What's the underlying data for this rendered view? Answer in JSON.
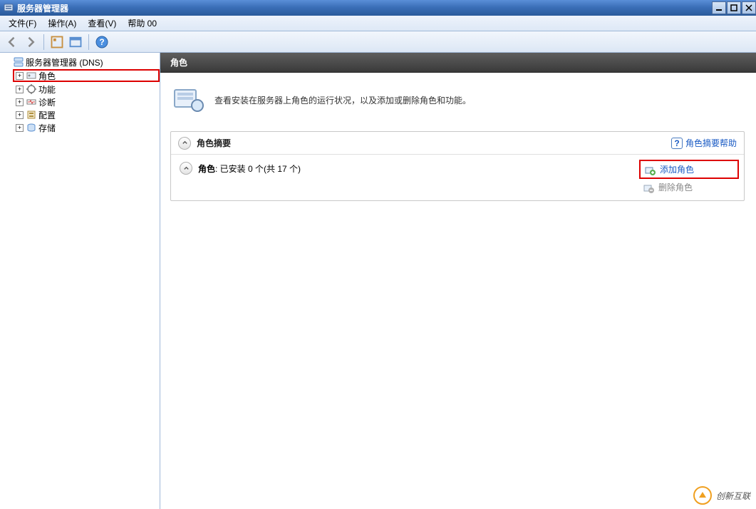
{
  "titlebar": {
    "title": "服务器管理器"
  },
  "menu": {
    "file": "文件(F)",
    "action": "操作(A)",
    "view": "查看(V)",
    "help": "帮助 00"
  },
  "tree": {
    "root_label": "服务器管理器 (DNS)",
    "items": [
      {
        "label": "角色",
        "highlighted": true
      },
      {
        "label": "功能"
      },
      {
        "label": "诊断"
      },
      {
        "label": "配置"
      },
      {
        "label": "存储"
      }
    ]
  },
  "content": {
    "header_title": "角色",
    "intro_text": "查看安装在服务器上角色的运行状况，以及添加或删除角色和功能。",
    "section_title": "角色摘要",
    "help_link_text": "角色摘要帮助",
    "roles_line_strong": "角色",
    "roles_line_rest": ": 已安装 0 个(共 17 个)",
    "add_role_label": "添加角色",
    "remove_role_label": "删除角色"
  },
  "watermark": {
    "text": "创新互联"
  }
}
